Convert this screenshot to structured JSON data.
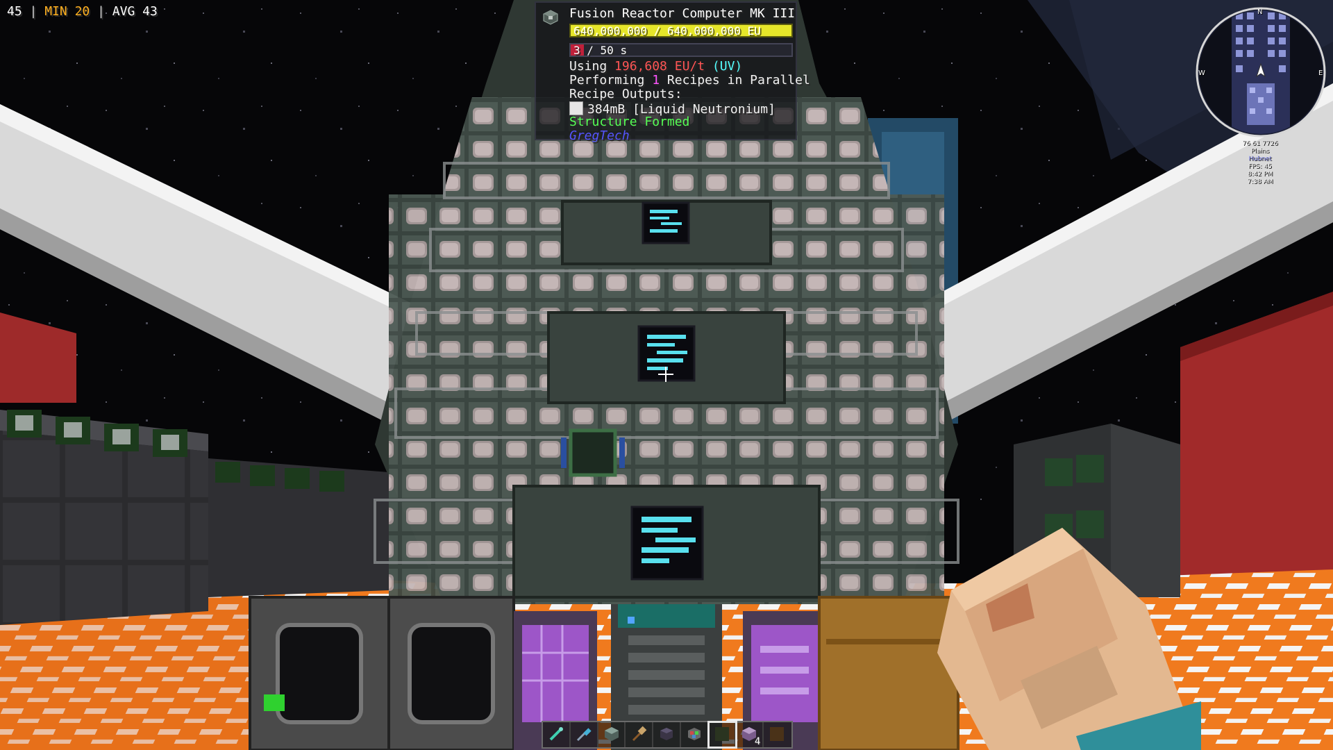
{
  "fps": {
    "current": "45",
    "separator": "|",
    "min_label": "MIN",
    "min_value": "20",
    "avg_label": "AVG",
    "avg_value": "43"
  },
  "waila": {
    "block_icon": "machine-casing-icon",
    "title": "Fusion Reactor Computer MK III",
    "energy": {
      "text": "640,000,000 / 640,000,000 EU",
      "fraction": 1.0,
      "color": "#e6e62a"
    },
    "progress": {
      "current": "3",
      "rest": "/ 50 s",
      "fraction": 0.06,
      "color": "#c0203a"
    },
    "using": {
      "prefix": "Using",
      "amount": "196,608 EU/t",
      "tier": "(UV)"
    },
    "performing": {
      "prefix": "Performing",
      "count": "1",
      "suffix": "Recipes in Parallel"
    },
    "outputs_header": "Recipe Outputs:",
    "output_item": "384mB [Liquid Neutronium]",
    "structure_status": "Structure Formed",
    "mod_name": "GregTech",
    "colors": {
      "red": "#ff5555",
      "cyan": "#55ffff",
      "pink": "#ff55ff",
      "green": "#55ff55",
      "blue": "#5555ff"
    }
  },
  "minimap": {
    "compass": {
      "north": "N",
      "west": "W",
      "east": "E"
    },
    "coords": "76 61 7726",
    "biome": "Plains",
    "dimension": "Hubnet",
    "fps_line": "FPS: 45",
    "time_real": "8:42 PM",
    "time_game": "7:38 AM"
  },
  "hotbar": {
    "selected_index": 6,
    "slots": [
      {
        "icon": "wrench-icon",
        "count": ""
      },
      {
        "icon": "screwdriver-icon",
        "count": ""
      },
      {
        "icon": "machine-casing-icon",
        "count": ""
      },
      {
        "icon": "hammer-icon",
        "count": ""
      },
      {
        "icon": "dark-block-icon",
        "count": ""
      },
      {
        "icon": "multicolor-block-icon",
        "count": ""
      },
      {
        "icon": "empty-slot-icon",
        "count": ""
      },
      {
        "icon": "purple-cube-icon",
        "count": "4"
      },
      {
        "icon": "brown-block-icon",
        "count": ""
      }
    ]
  }
}
